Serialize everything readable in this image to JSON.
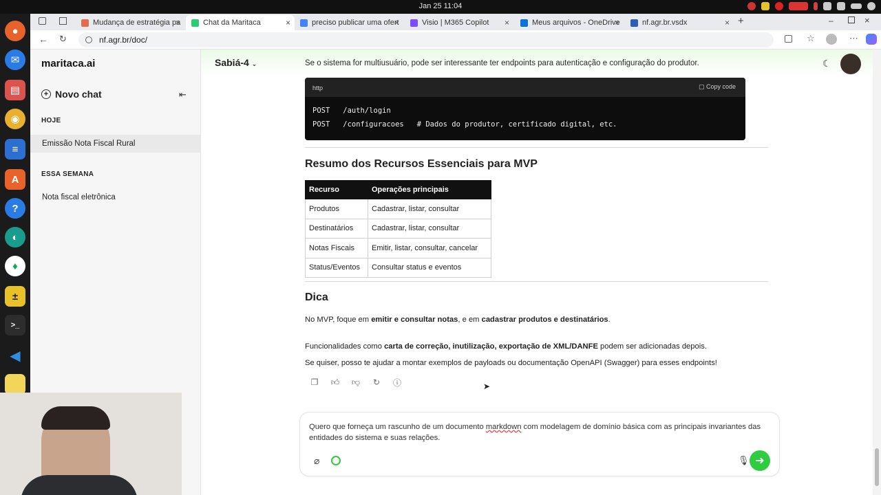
{
  "os": {
    "clock": "Jan 25  11:04"
  },
  "tabs": [
    {
      "title": "Mudança de estratégia pa",
      "fav": "#e26c4d"
    },
    {
      "title": "Chat da Maritaca",
      "fav": "#2ecc71"
    },
    {
      "title": "preciso publicar uma ofert",
      "fav": "#4285f4"
    },
    {
      "title": "Visio | M365 Copilot",
      "fav": "#7d4dff"
    },
    {
      "title": "Meus arquivos - OneDrive",
      "fav": "#0a73d6"
    },
    {
      "title": "nf.agr.br.vsdx",
      "fav": "#2b5fb4"
    }
  ],
  "address": {
    "url": "nf.agr.br/doc/"
  },
  "sidebar": {
    "brand": "maritaca.ai",
    "new_chat": "Novo chat",
    "today_label": "HOJE",
    "today_items": [
      "Emissão Nota Fiscal Rural"
    ],
    "week_label": "ESSA SEMANA",
    "week_items": [
      "Nota fiscal eletrônica"
    ]
  },
  "header": {
    "model": "Sabiá-4"
  },
  "chat": {
    "intro": "Se o sistema for multiusuário, pode ser interessante ter endpoints para autenticação e configuração do produtor.",
    "code": {
      "lang": "http",
      "copy": "Copy code",
      "line1": "POST   /auth/login",
      "line2": "POST   /configuracoes   # Dados do produtor, certificado digital, etc."
    },
    "summary_title": "Resumo dos Recursos Essenciais para MVP",
    "table": {
      "headers": [
        "Recurso",
        "Operações principais"
      ],
      "rows": [
        [
          "Produtos",
          "Cadastrar, listar, consultar"
        ],
        [
          "Destinatários",
          "Cadastrar, listar, consultar"
        ],
        [
          "Notas Fiscais",
          "Emitir, listar, consultar, cancelar"
        ],
        [
          "Status/Eventos",
          "Consultar status e eventos"
        ]
      ]
    },
    "tip_title": "Dica",
    "tip1_a": "No MVP, foque em ",
    "tip1_b": "emitir e consultar notas",
    "tip1_c": ", e em ",
    "tip1_d": "cadastrar produtos e destinatários",
    "tip1_e": ".",
    "tip2_a": "Funcionalidades como ",
    "tip2_b": "carta de correção, inutilização, exportação de XML/DANFE",
    "tip2_c": " podem ser adicionadas depois.",
    "tip3": "Se quiser, posso te ajudar a montar exemplos de payloads ou documentação OpenAPI (Swagger) para esses endpoints!"
  },
  "composer": {
    "text_a": "Quero que forneça um rascunho de um documento ",
    "text_misspelled": "markdown",
    "text_b": " com modelagem de domínio básica com as principais invariantes das entidades do sistema e suas relações."
  }
}
